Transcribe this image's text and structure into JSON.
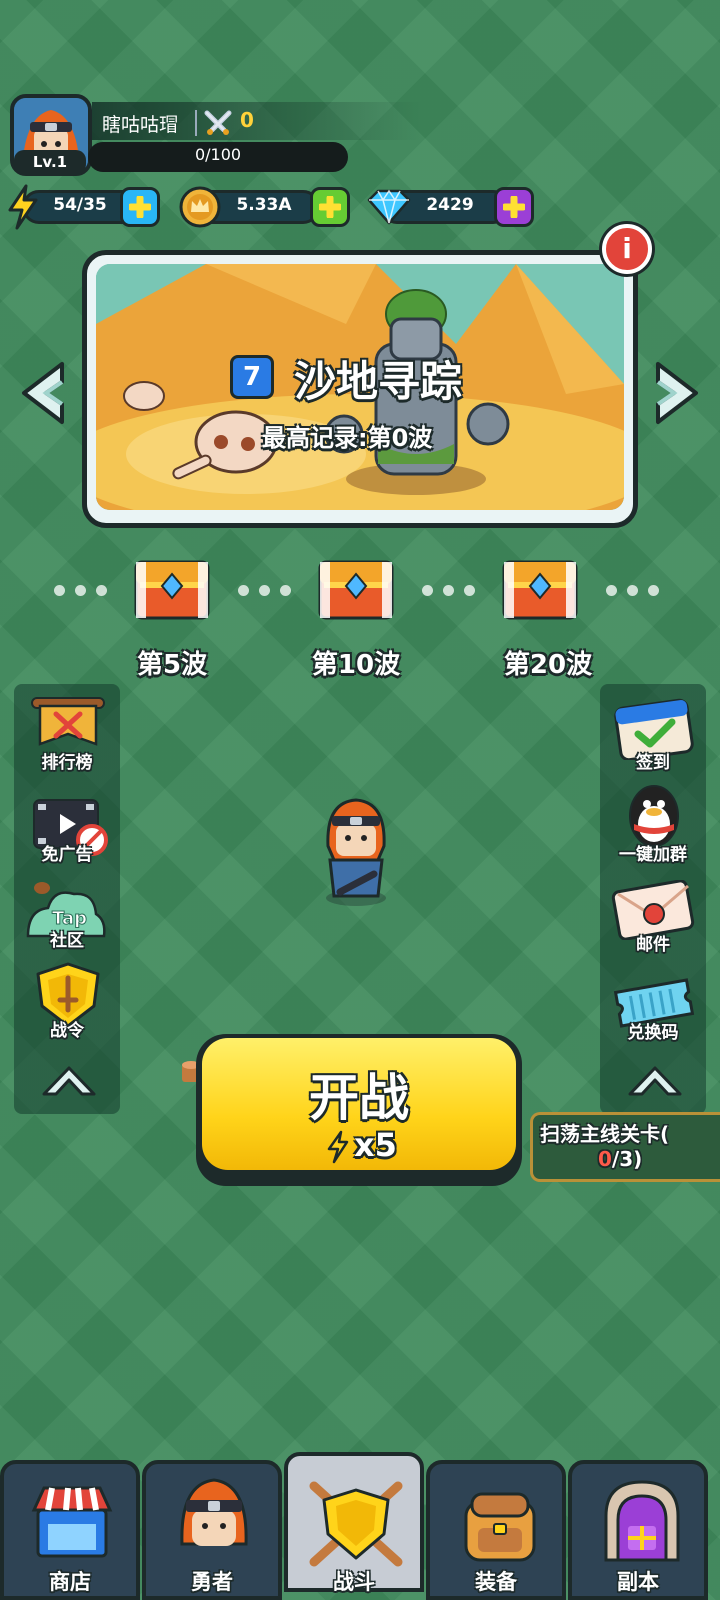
{
  "profile": {
    "name": "瞎咕咕瑁",
    "level": "Lv.1",
    "power": "0",
    "xp": "0/100"
  },
  "resources": {
    "energy": "54/35",
    "gold": "5.33A",
    "gems": "2429"
  },
  "stage": {
    "number": "7",
    "name": "沙地寻踪",
    "best_record": "最高记录:第0波",
    "info_icon": "i"
  },
  "chests": [
    {
      "label": "第5波"
    },
    {
      "label": "第10波"
    },
    {
      "label": "第20波"
    }
  ],
  "left_menu": [
    {
      "label": "排行榜"
    },
    {
      "label": "免广告"
    },
    {
      "label": "社区",
      "badge": "Tap"
    },
    {
      "label": "战令"
    }
  ],
  "right_menu": [
    {
      "label": "签到"
    },
    {
      "label": "一键加群"
    },
    {
      "label": "邮件"
    },
    {
      "label": "兑换码"
    }
  ],
  "start": {
    "label": "开战",
    "cost": "x5"
  },
  "sweep": {
    "title": "扫荡主线关卡(",
    "count_current": "0",
    "count_rest": "/3)"
  },
  "nav": [
    {
      "label": "商店"
    },
    {
      "label": "勇者"
    },
    {
      "label": "战斗",
      "active": true
    },
    {
      "label": "装备"
    },
    {
      "label": "副本"
    }
  ],
  "colors": {
    "accent_yellow": "#ffd41a",
    "plus_blue": "#29b6f6",
    "plus_green": "#66cc33",
    "plus_purple": "#9b3fd6",
    "stage_badge": "#2a7be4",
    "info_red": "#e2443a"
  }
}
